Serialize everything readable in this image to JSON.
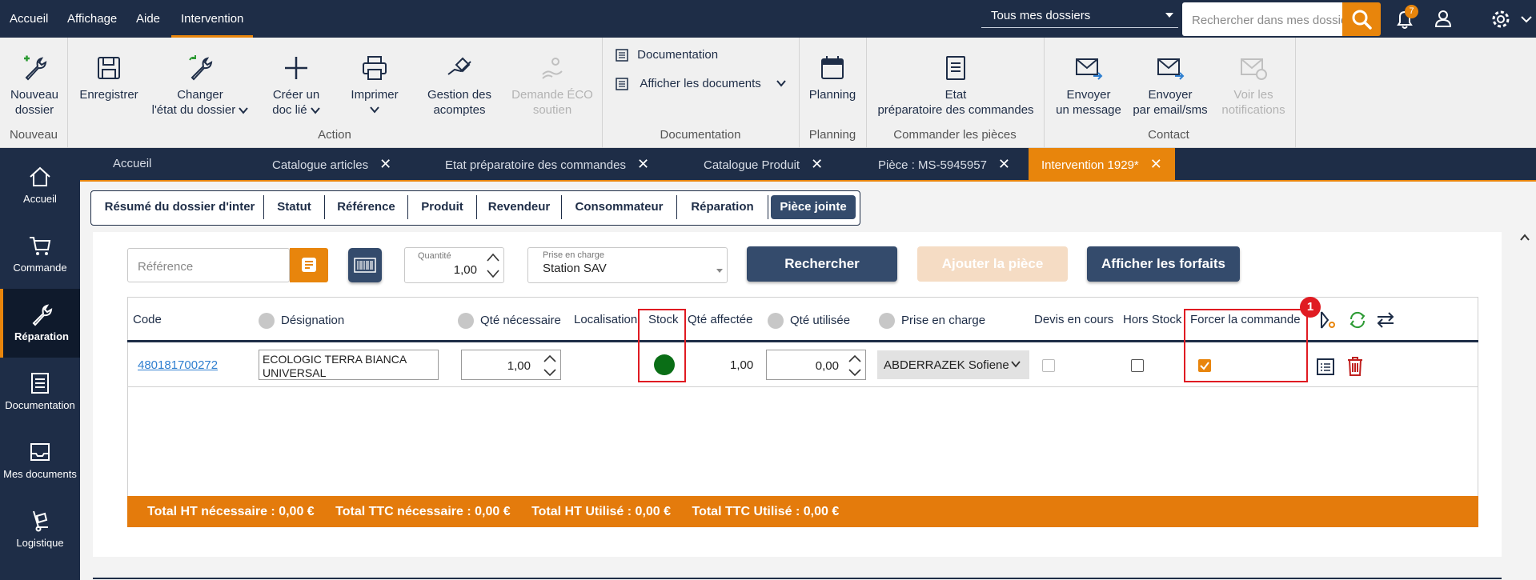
{
  "topbar": {
    "menu": [
      "Accueil",
      "Affichage",
      "Aide",
      "Intervention"
    ],
    "dossier_select": "Tous mes dossiers",
    "search_placeholder": "Rechercher dans mes dossiers",
    "notifications_count": "7"
  },
  "ribbon": {
    "nouveau_dossier": [
      "Nouveau",
      "dossier"
    ],
    "enregistrer": "Enregistrer",
    "changer_etat": [
      "Changer",
      "l'état du dossier"
    ],
    "creer_doc": [
      "Créer un",
      "doc lié"
    ],
    "imprimer": "Imprimer",
    "gestion_acomptes": [
      "Gestion des",
      "acomptes"
    ],
    "demande_eco": [
      "Demande ÉCO",
      "soutien"
    ],
    "documentation": "Documentation",
    "afficher_documents": "Afficher les documents",
    "planning": "Planning",
    "etat_preparatoire": [
      "Etat",
      "préparatoire des commandes"
    ],
    "envoyer_message": [
      "Envoyer",
      "un message"
    ],
    "envoyer_email": [
      "Envoyer",
      "par email/sms"
    ],
    "voir_notifications": [
      "Voir les",
      "notifications"
    ],
    "groups": {
      "nouveau": "Nouveau",
      "action": "Action",
      "documentation": "Documentation",
      "planning": "Planning",
      "commander": "Commander les pièces",
      "contact": "Contact"
    }
  },
  "sidebar": {
    "items": [
      "Accueil",
      "Commande",
      "Réparation",
      "Documentation",
      "Mes documents",
      "Logistique"
    ]
  },
  "tabs": [
    "Accueil",
    "Catalogue articles",
    "Etat préparatoire des commandes",
    "Catalogue Produit",
    "Pièce : MS-5945957",
    "Intervention 1929*"
  ],
  "segments": [
    "Résumé du dossier d'inter",
    "Statut",
    "Référence",
    "Produit",
    "Revendeur",
    "Consommateur",
    "Réparation",
    "Pièce jointe"
  ],
  "filters": {
    "reference_placeholder": "Référence",
    "quantite_label": "Quantité",
    "quantite_value": "1,00",
    "prise_label": "Prise en charge",
    "prise_value": "Station SAV",
    "rechercher": "Rechercher",
    "ajouter": "Ajouter la pièce",
    "forfaits": "Afficher les forfaits"
  },
  "table": {
    "headers": [
      "Code",
      "Désignation",
      "Qté nécessaire",
      "Localisation",
      "Stock",
      "Qté affectée",
      "Qté utilisée",
      "Prise en charge",
      "Devis en cours",
      "Hors Stock",
      "Forcer la commande"
    ],
    "row": {
      "code": "480181700272",
      "designation": "ECOLOGIC TERRA BIANCA UNIVERSAL",
      "qte_necessaire": "1,00",
      "stock_color": "#0a6e16",
      "qte_affectee": "1,00",
      "qte_utilisee": "0,00",
      "prise_en_charge": "ABDERRAZEK Sofiene",
      "devis_en_cours": false,
      "hors_stock": false,
      "forcer_commande": true
    }
  },
  "badge_marker": "1",
  "totals": {
    "ht_necessaire": "Total HT nécessaire : 0,00 €",
    "ttc_necessaire": "Total TTC nécessaire : 0,00 €",
    "ht_utilise": "Total HT Utilisé : 0,00 €",
    "ttc_utilise": "Total TTC Utilisé : 0,00 €"
  },
  "colors": {
    "navy": "#1e2d47",
    "accent": "#e8850c",
    "highlight": "#e01b22"
  }
}
